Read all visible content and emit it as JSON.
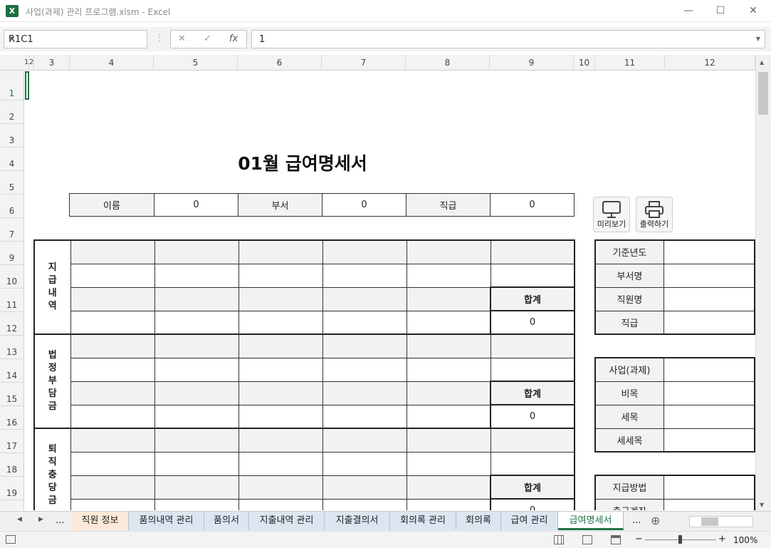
{
  "window": {
    "title": "사업(과제) 관리 프로그램.xlsm - Excel",
    "logo": "X",
    "minimize": "—",
    "maximize": "☐",
    "close": "✕"
  },
  "formula_bar": {
    "name_box": "R1C1",
    "cancel": "✕",
    "enter": "✓",
    "fx": "fx",
    "value": "1"
  },
  "columns": [
    "1",
    "2",
    "3",
    "4",
    "5",
    "6",
    "7",
    "8",
    "9",
    "10",
    "11",
    "12"
  ],
  "rows": [
    "1",
    "2",
    "3",
    "4",
    "5",
    "6",
    "7",
    "9",
    "10",
    "11",
    "12",
    "13",
    "14",
    "15",
    "16",
    "17",
    "18",
    "19"
  ],
  "sheet": {
    "title": "01월 급여명세서",
    "info": {
      "name_label": "이름",
      "name_value": "0",
      "dept_label": "부서",
      "dept_value": "0",
      "rank_label": "직급",
      "rank_value": "0"
    },
    "sections": {
      "pay": "지\n급\n내\n역",
      "legal": "법\n정\n부\n담\n금",
      "retire": "퇴\n직\n충\n당\n금"
    },
    "sum_label": "합계",
    "sum_value": "0",
    "buttons": {
      "preview": "미리보기",
      "print": "출력하기"
    },
    "side_top": [
      "기준년도",
      "부서명",
      "직원명",
      "직급"
    ],
    "side_mid": [
      "사업(과제)",
      "비목",
      "세목",
      "세세목"
    ],
    "side_bot": [
      "지급방법",
      "출금계좌"
    ]
  },
  "tabs": [
    "직원 정보",
    "품의내역 관리",
    "품의서",
    "지출내역 관리",
    "지출결의서",
    "회의록 관리",
    "회의록",
    "급여 관리",
    "급여명세서"
  ],
  "tab_nav": {
    "prev": "◀",
    "next": "▶",
    "more": "...",
    "more_right": "...",
    "add": "⊕"
  },
  "status": {
    "zoom": "100%",
    "minus": "−",
    "plus": "+"
  },
  "colors": {
    "excel_green": "#217346",
    "tab_staff": "#fde9d9",
    "tab_blue": "#dce6f1",
    "active_tab": "#ffffff"
  }
}
